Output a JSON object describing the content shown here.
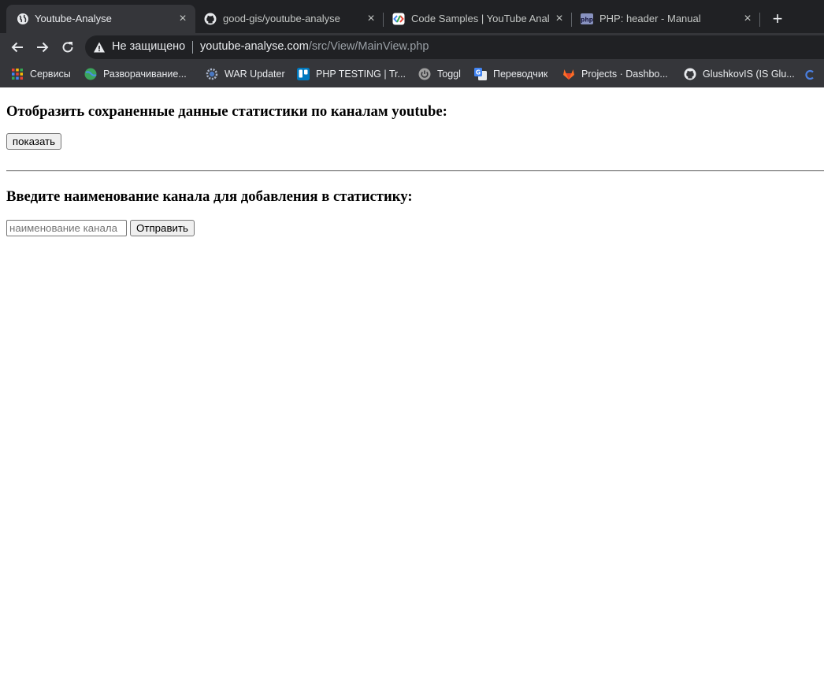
{
  "browser": {
    "tabs": [
      {
        "title": "Youtube-Analyse",
        "icon": "globe-icon",
        "active": true
      },
      {
        "title": "good-gis/youtube-analyse",
        "icon": "github-icon",
        "active": false
      },
      {
        "title": "Code Samples  |  YouTube Anal",
        "icon": "google-developers-icon",
        "active": false
      },
      {
        "title": "PHP: header - Manual",
        "icon": "php-icon",
        "active": false
      }
    ],
    "new_tab": "+",
    "close_glyph": "×",
    "security_label": "Не защищено",
    "url_host": "youtube-analyse.com",
    "url_path": "/src/View/MainView.php",
    "bookmarks": [
      {
        "label": "Сервисы",
        "icon": "apps-grid-icon"
      },
      {
        "label": "Разворачивание...",
        "icon": "globe-green-icon"
      },
      {
        "label": "WAR Updater",
        "icon": "gear-icon"
      },
      {
        "label": "PHP TESTING | Tr...",
        "icon": "trello-icon"
      },
      {
        "label": "Toggl",
        "icon": "toggl-power-icon"
      },
      {
        "label": "Переводчик",
        "icon": "google-translate-icon"
      },
      {
        "label": "Projects · Dashbo...",
        "icon": "gitlab-icon"
      },
      {
        "label": "GlushkovIS (IS Glu...",
        "icon": "github-icon"
      }
    ],
    "colors": {
      "frame": "#202124",
      "toolbar": "#35363a",
      "text": "#e8eaed",
      "muted": "#9aa0a6"
    }
  },
  "page": {
    "show_section": {
      "heading": "Отобразить сохраненные данные статистики по каналам youtube:",
      "button_label": "показать"
    },
    "add_section": {
      "heading": "Введите наименование канала для добавления в статистику:",
      "input_value": "",
      "input_placeholder": "наименование канала",
      "submit_label": "Отправить"
    }
  }
}
